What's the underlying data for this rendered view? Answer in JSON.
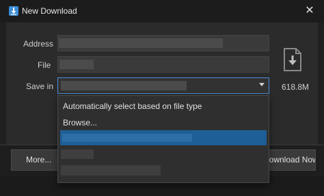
{
  "window": {
    "title": "New Download",
    "close_glyph": "✕"
  },
  "form": {
    "address_label": "Address",
    "file_label": "File",
    "save_in_label": "Save in",
    "size_text": "618.8M"
  },
  "dropdown": {
    "options": [
      "Automatically select based on file type",
      "Browse..."
    ]
  },
  "buttons": {
    "more_label": "More...",
    "download_label": "Download Now"
  },
  "icons": {
    "app": "download-arrow-icon",
    "file": "file-download-icon",
    "close": "close-icon",
    "caret": "chevron-down-icon"
  },
  "colors": {
    "accent": "#4a90d9",
    "highlight": "#1e5f97",
    "app_icon": "#3d8fd6"
  }
}
